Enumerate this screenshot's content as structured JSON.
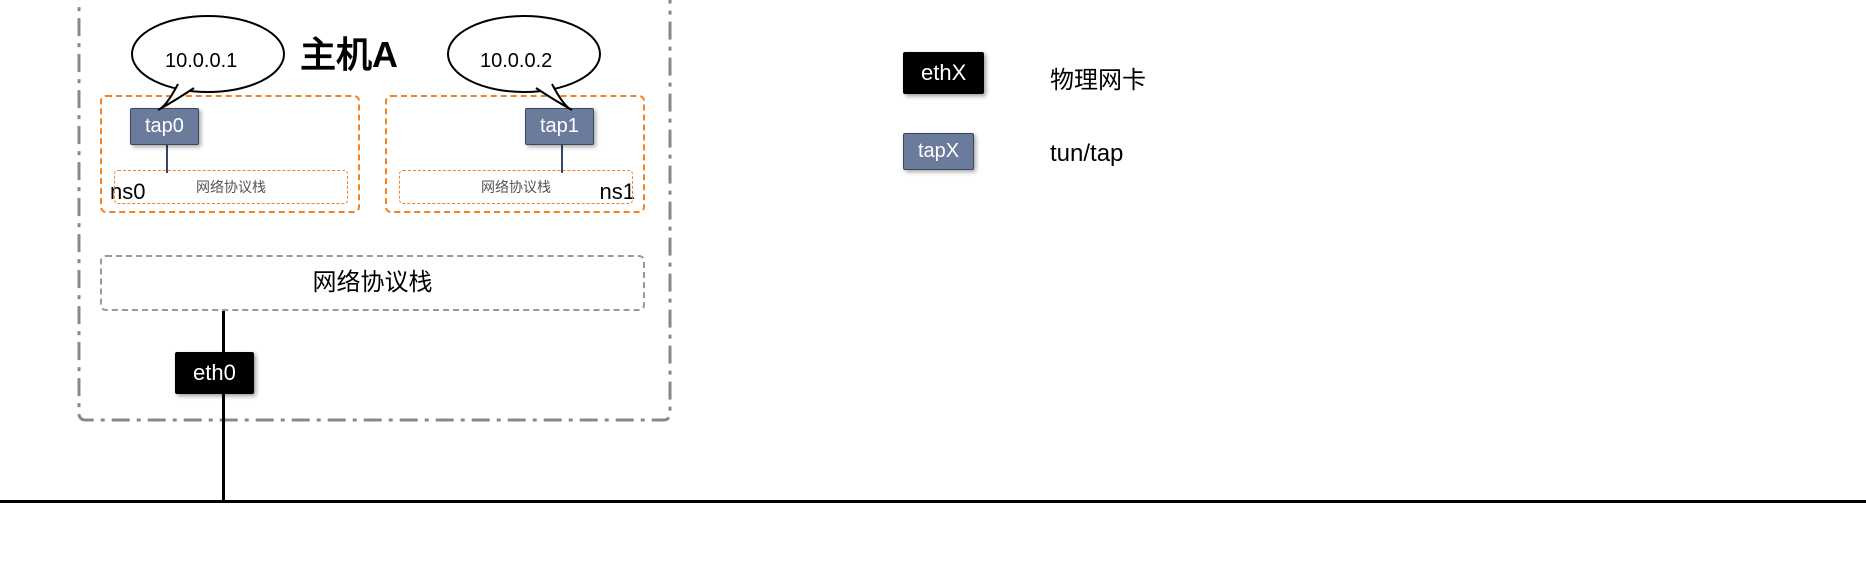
{
  "host": {
    "title": "主机A",
    "ns0": {
      "label": "ns0",
      "tap": "tap0",
      "ip": "10.0.0.1",
      "stack": "网络协议栈"
    },
    "ns1": {
      "label": "ns1",
      "tap": "tap1",
      "ip": "10.0.0.2",
      "stack": "网络协议栈"
    },
    "main_stack": "网络协议栈",
    "eth0": "eth0"
  },
  "legend": {
    "ethx": "ethX",
    "ethx_desc": "物理网卡",
    "tapx": "tapX",
    "tapx_desc": "tun/tap"
  }
}
